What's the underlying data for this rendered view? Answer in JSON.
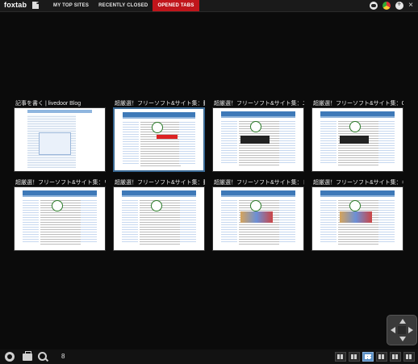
{
  "app": {
    "logo": "foxtab"
  },
  "tabs": [
    {
      "label": "MY TOP SITES",
      "active": false
    },
    {
      "label": "RECENTLY CLOSED",
      "active": false
    },
    {
      "label": "OPENED TABS",
      "active": true
    }
  ],
  "accent_color": "#c0151b",
  "selection_color": "#3a6a95",
  "thumbnails": [
    {
      "title": "記事を書く | livedoor Blog",
      "kind": "blog"
    },
    {
      "title": "超厳選！フリーソフト&サイト集：動画ウィ",
      "kind": "red",
      "selected": true
    },
    {
      "title": "超厳選！フリーソフト&サイト集：ニコニコ動",
      "kind": "dark"
    },
    {
      "title": "超厳選！フリーソフト&サイト集：CPUやH",
      "kind": "dark"
    },
    {
      "title": "超厳選！フリーソフト&サイト集：リンク3対",
      "kind": "plain"
    },
    {
      "title": "超厳選！フリーソフト&サイト集：動画ウィ",
      "kind": "plain"
    },
    {
      "title": "超厳選！フリーソフト&サイト集：ドラッグ＆",
      "kind": "img"
    },
    {
      "title": "超厳選！フリーソフト&サイト集：キャッシ",
      "kind": "img"
    }
  ],
  "bottom": {
    "count": "8"
  },
  "icons": {
    "top_right": [
      "visibility-icon",
      "chrome-icon",
      "add-icon",
      "close-icon"
    ],
    "bottom_left": [
      "settings-gear-icon",
      "briefcase-icon",
      "search-icon"
    ],
    "bottom_right": [
      "layout-list-icon",
      "layout-strip-icon",
      "layout-grid-icon",
      "layout-dense-grid-icon",
      "layout-3d-icon",
      "layout-stack-icon"
    ]
  }
}
